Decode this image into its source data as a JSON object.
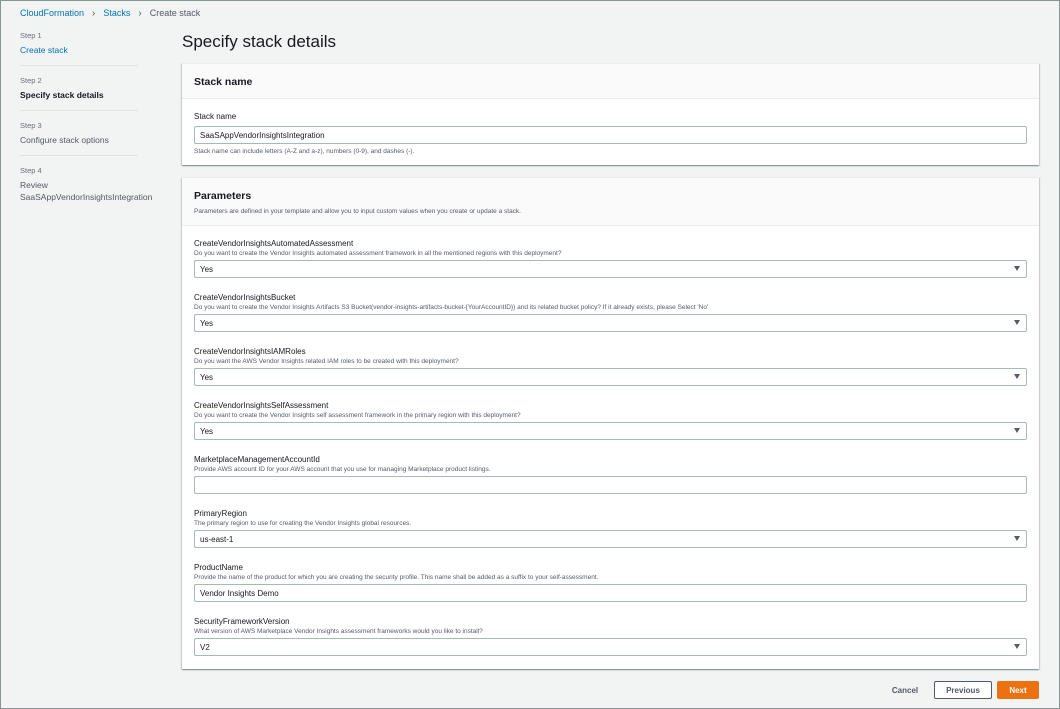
{
  "breadcrumb": {
    "root": "CloudFormation",
    "stacks": "Stacks",
    "current": "Create stack"
  },
  "steps": [
    {
      "num": "Step 1",
      "label": "Create stack",
      "state": "link"
    },
    {
      "num": "Step 2",
      "label": "Specify stack details",
      "state": "active"
    },
    {
      "num": "Step 3",
      "label": "Configure stack options",
      "state": "normal"
    },
    {
      "num": "Step 4",
      "label": "Review SaaSAppVendorInsightsIntegration",
      "state": "normal"
    }
  ],
  "page_title": "Specify stack details",
  "stack_name_panel": {
    "heading": "Stack name",
    "field_label": "Stack name",
    "value": "SaaSAppVendorInsightsIntegration",
    "hint": "Stack name can include letters (A-Z and a-z), numbers (0-9), and dashes (-)."
  },
  "parameters_panel": {
    "heading": "Parameters",
    "description": "Parameters are defined in your template and allow you to input custom values when you create or update a stack.",
    "params": [
      {
        "name": "CreateVendorInsightsAutomatedAssessment",
        "desc": "Do you want to create the Vendor Insights automated assessment framework in all the mentioned regions with this deployment?",
        "value": "Yes",
        "type": "select"
      },
      {
        "name": "CreateVendorInsightsBucket",
        "desc": "Do you want to create the Vendor Insights Artifacts S3 Bucket(vendor-insights-artifacts-bucket-{YourAccountID}) and its related bucket policy? If it already exists, please Select 'No'",
        "value": "Yes",
        "type": "select"
      },
      {
        "name": "CreateVendorInsightsIAMRoles",
        "desc": "Do you want the AWS Vendor Insights related IAM roles to be created with this deployment?",
        "value": "Yes",
        "type": "select"
      },
      {
        "name": "CreateVendorInsightsSelfAssessment",
        "desc": "Do you want to create the Vendor Insights self assessment framework in the primary region with this deployment?",
        "value": "Yes",
        "type": "select"
      },
      {
        "name": "MarketplaceManagementAccountId",
        "desc": "Provide AWS account ID for your AWS account that you use for managing Marketplace product listings.",
        "value": "",
        "type": "input"
      },
      {
        "name": "PrimaryRegion",
        "desc": "The primary region to use for creating the Vendor Insights global resources.",
        "value": "us-east-1",
        "type": "select"
      },
      {
        "name": "ProductName",
        "desc": "Provide the name of the product for which you are creating the security profile. This name shall be added as a suffix to your self-assessment.",
        "value": "Vendor Insights Demo",
        "type": "input"
      },
      {
        "name": "SecurityFrameworkVersion",
        "desc": "What version of AWS Marketplace Vendor Insights assessment frameworks would you like to install?",
        "value": "V2",
        "type": "select"
      }
    ]
  },
  "footer": {
    "cancel": "Cancel",
    "previous": "Previous",
    "next": "Next"
  },
  "colors": {
    "link": "#0073bb",
    "primary_button": "#ec7211",
    "background": "#f2f3f3"
  },
  "icons": {
    "breadcrumb_separator": "chevron-right-icon",
    "select_caret": "caret-down-icon"
  }
}
